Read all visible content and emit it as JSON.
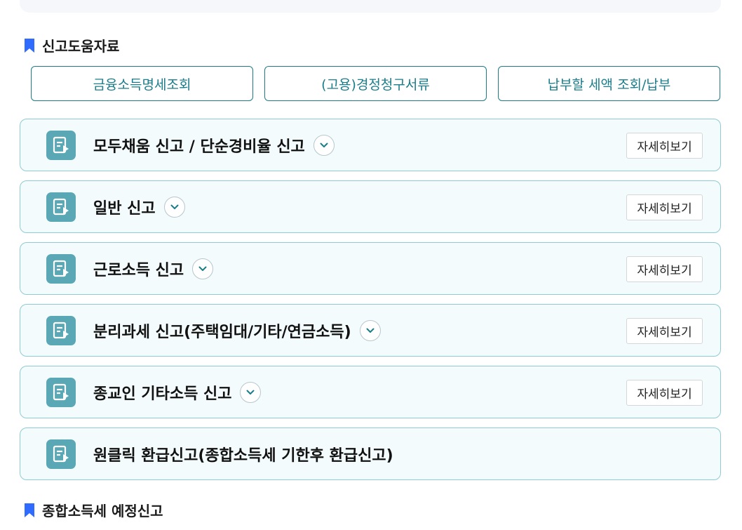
{
  "help_section": {
    "title": "신고도움자료",
    "buttons": [
      "금융소득명세조회",
      "(고용)경정청구서류",
      "납부할 세액 조회/납부"
    ]
  },
  "report_items": [
    {
      "label": "모두채움 신고 / 단순경비율 신고",
      "detail": "자세히보기"
    },
    {
      "label": "일반 신고",
      "detail": "자세히보기"
    },
    {
      "label": "근로소득 신고",
      "detail": "자세히보기"
    },
    {
      "label": "분리과세 신고(주택임대/기타/연금소득)",
      "detail": "자세히보기"
    },
    {
      "label": "종교인 기타소득 신고",
      "detail": "자세히보기"
    },
    {
      "label": "원클릭 환급신고(종합소득세 기한후 환급신고)"
    }
  ],
  "next_section": {
    "title": "종합소득세 예정신고"
  },
  "colors": {
    "accent_blue": "#2f6bff",
    "teal": "#1b7d8a",
    "card_border": "#8fcbd2",
    "card_bg": "#f3fbfc",
    "icon_bg": "#5aa8b5"
  },
  "icons": {
    "section_marker": "bookmark-icon",
    "card_icon": "document-play-icon",
    "expand": "chevron-down-icon"
  }
}
